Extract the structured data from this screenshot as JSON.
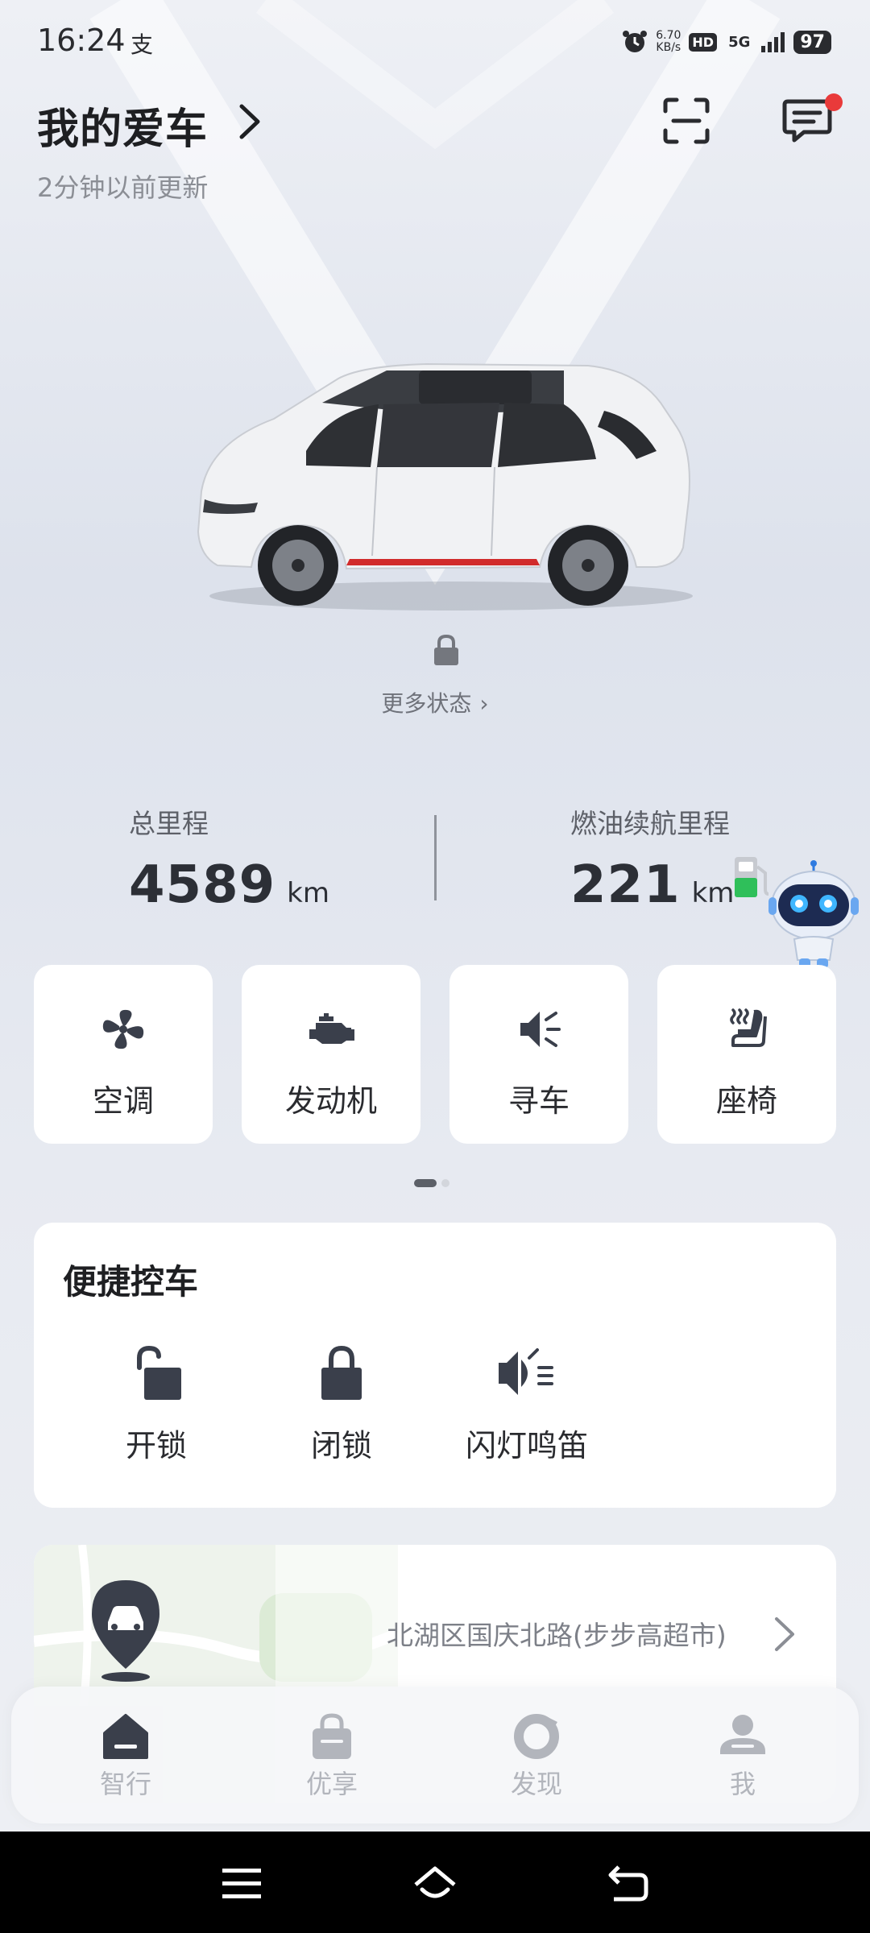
{
  "status_bar": {
    "time": "16:24",
    "pay_icon": "支",
    "speed_value": "6.70",
    "speed_unit": "KB/s",
    "hd": "HD",
    "network": "5G",
    "battery": "97",
    "icons": [
      "alarm-icon",
      "signal-icon",
      "battery-icon"
    ]
  },
  "header": {
    "title": "我的爱车",
    "updated": "2分钟以前更新"
  },
  "car": {
    "more_status": "更多状态"
  },
  "stats": {
    "total_label": "总里程",
    "total_value": "4589",
    "total_unit": "km",
    "range_label": "燃油续航里程",
    "range_value": "221",
    "range_unit": "km"
  },
  "tiles": [
    {
      "label": "空调",
      "icon": "fan-icon"
    },
    {
      "label": "发动机",
      "icon": "engine-icon"
    },
    {
      "label": "寻车",
      "icon": "horn-icon"
    },
    {
      "label": "座椅",
      "icon": "seat-heat-icon"
    }
  ],
  "quick_control": {
    "title": "便捷控车",
    "items": [
      {
        "label": "开锁",
        "icon": "unlock-icon"
      },
      {
        "label": "闭锁",
        "icon": "lock-icon"
      },
      {
        "label": "闪灯鸣笛",
        "icon": "flash-horn-icon"
      }
    ]
  },
  "location": {
    "address": "北湖区国庆北路(步步高超市)"
  },
  "bottom_nav": [
    {
      "label": "智行",
      "icon": "home-icon",
      "active": true
    },
    {
      "label": "优享",
      "icon": "shopping-bag-icon",
      "active": false
    },
    {
      "label": "发现",
      "icon": "discover-icon",
      "active": false
    },
    {
      "label": "我",
      "icon": "profile-icon",
      "active": false
    }
  ],
  "colors": {
    "accent_dark": "#3a3f4b",
    "badge_red": "#e93a3a",
    "fuel_green": "#2fbf5a",
    "muted_text": "#8b8e95"
  }
}
